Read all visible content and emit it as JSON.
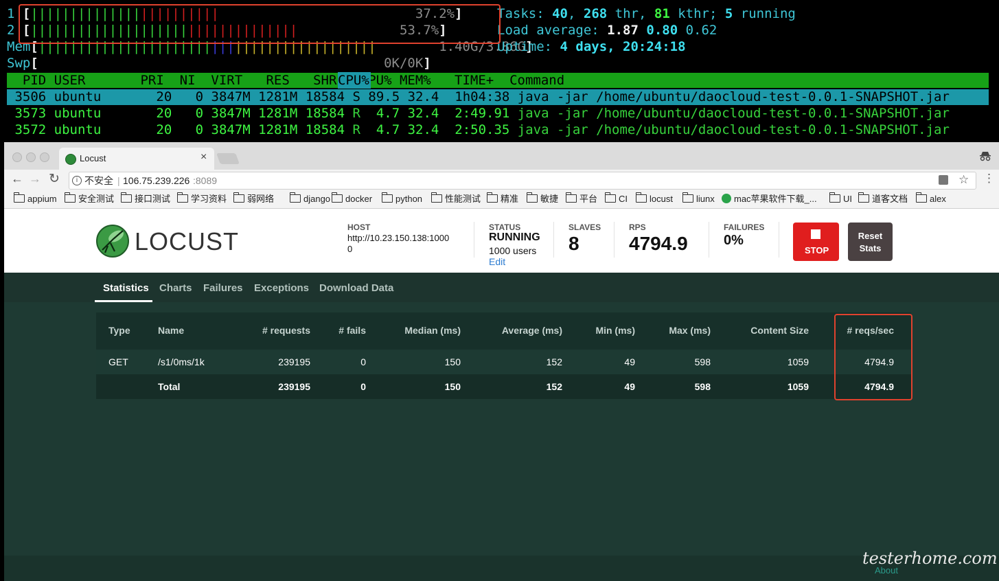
{
  "htop": {
    "cpu1": {
      "num": "1",
      "bar_green": "||||||||||||||",
      "bar_red": "||||||||||",
      "pct": "37.2%"
    },
    "cpu2": {
      "num": "2",
      "bar_green": "||||||||||||||||||||",
      "bar_red": "||||||||||||||",
      "pct": "53.7%"
    },
    "mem": {
      "label": "Mem",
      "bar_green": "||||||||||||||||||||||",
      "bar_blue": "|||",
      "bar_yellow": "||||||||||||||||||",
      "value": "1.40G/3.86G"
    },
    "swp": {
      "label": "Swp",
      "value": "0K/0K"
    },
    "tasks": {
      "label": "Tasks:",
      "tasks": "40",
      "thr": "268",
      "thr_label": "thr,",
      "kthr": "81",
      "kthr_label": "kthr;",
      "running": "5",
      "running_label": "running"
    },
    "load": {
      "label": "Load average:",
      "l1": "1.87",
      "l5": "0.80",
      "l15": "0.62"
    },
    "uptime": {
      "label": "Uptime:",
      "value": "4 days, 20:24:18"
    },
    "header": "  PID USER       PRI  NI  VIRT   RES   SHR S CPU% MEM%   TIME+  Command",
    "processes": [
      {
        "pid": " 3506",
        "user": "ubuntu",
        "pri": "20",
        "ni": "0",
        "virt": "3847M",
        "res": "1281M",
        "shr": "18584",
        "s": "S",
        "cpu": "89.5",
        "mem": "32.4",
        "time": "1h04:38",
        "cmd": "java -jar /home/ubuntu/daocloud-test-0.0.1-SNAPSHOT.jar"
      },
      {
        "pid": " 3573",
        "user": "ubuntu",
        "pri": "20",
        "ni": "0",
        "virt": "3847M",
        "res": "1281M",
        "shr": "18584",
        "s": "R",
        "cpu": " 4.7",
        "mem": "32.4",
        "time": "2:49.91",
        "cmd": "java -jar /home/ubuntu/daocloud-test-0.0.1-SNAPSHOT.jar"
      },
      {
        "pid": " 3572",
        "user": "ubuntu",
        "pri": "20",
        "ni": "0",
        "virt": "3847M",
        "res": "1281M",
        "shr": "18584",
        "s": "R",
        "cpu": " 4.7",
        "mem": "32.4",
        "time": "2:50.35",
        "cmd": "java -jar /home/ubuntu/daocloud-test-0.0.1-SNAPSHOT.jar"
      }
    ]
  },
  "browser": {
    "tab_title": "Locust",
    "tab_close": "×",
    "security_label": "不安全",
    "url_host": "106.75.239.226",
    "url_port": ":8089",
    "bookmarks": [
      "appium",
      "安全测试",
      "接口测试",
      "学习资料",
      "弱网络",
      "django",
      "docker",
      "python",
      "性能测试",
      "精准",
      "敏捷",
      "平台",
      "CI",
      "locust",
      "liunx",
      "mac苹果软件下载_...",
      "UI",
      "道客文档",
      "alex"
    ]
  },
  "locust": {
    "logo_text": "LOCUST",
    "host_label": "HOST",
    "host_value": "http://10.23.150.138:1000",
    "host_value2": "0",
    "status_label": "STATUS",
    "status_value": "RUNNING",
    "status_users": "1000 users",
    "status_edit": "Edit",
    "slaves_label": "SLAVES",
    "slaves_value": "8",
    "rps_label": "RPS",
    "rps_value": "4794.9",
    "failures_label": "FAILURES",
    "failures_value": "0%",
    "stop_label": "STOP",
    "reset_label_1": "Reset",
    "reset_label_2": "Stats",
    "tabs": [
      "Statistics",
      "Charts",
      "Failures",
      "Exceptions",
      "Download Data"
    ],
    "table": {
      "headers": [
        "Type",
        "Name",
        "# requests",
        "# fails",
        "Median (ms)",
        "Average (ms)",
        "Min (ms)",
        "Max (ms)",
        "Content Size",
        "# reqs/sec"
      ],
      "rows": [
        [
          "GET",
          "/s1/0ms/1k",
          "239195",
          "0",
          "150",
          "152",
          "49",
          "598",
          "1059",
          "4794.9"
        ],
        [
          "",
          "Total",
          "239195",
          "0",
          "150",
          "152",
          "49",
          "598",
          "1059",
          "4794.9"
        ]
      ]
    },
    "footer_link": "About",
    "watermark": "testerhome.com"
  },
  "colors": {
    "accent_red": "#e0422e",
    "stop_red": "#e01e1e",
    "locust_green": "#1e3a33"
  }
}
